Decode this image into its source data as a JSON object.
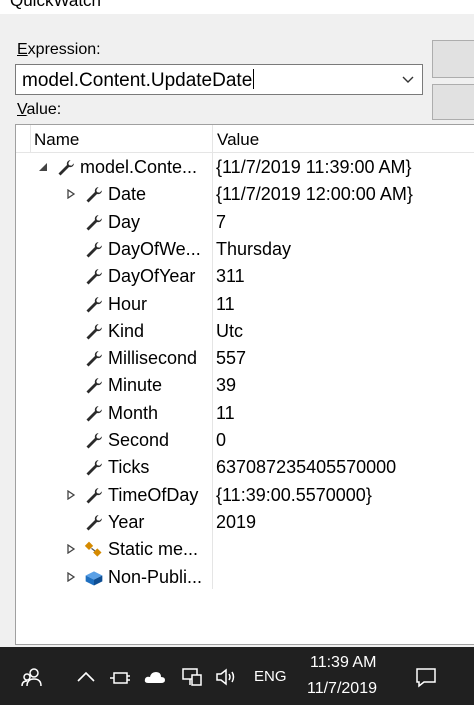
{
  "window": {
    "title": "QuickWatch"
  },
  "expression": {
    "label_prefix": "",
    "label_access": "E",
    "label_rest": "xpression:",
    "value": "model.Content.UpdateDate"
  },
  "value_section": {
    "label_access": "V",
    "label_rest": "alue:"
  },
  "grid": {
    "columns": [
      "Name",
      "Value"
    ],
    "rows": [
      {
        "name": "model.Conte...",
        "value": "{11/7/2019 11:39:00 AM}",
        "expander": "expanded",
        "icon": "wrench-icon",
        "indent": 0
      },
      {
        "name": "Date",
        "value": "{11/7/2019 12:00:00 AM}",
        "expander": "collapsed",
        "icon": "wrench-icon",
        "indent": 1
      },
      {
        "name": "Day",
        "value": "7",
        "expander": "none",
        "icon": "wrench-icon",
        "indent": 1
      },
      {
        "name": "DayOfWe...",
        "value": "Thursday",
        "expander": "none",
        "icon": "wrench-icon",
        "indent": 1
      },
      {
        "name": "DayOfYear",
        "value": "311",
        "expander": "none",
        "icon": "wrench-icon",
        "indent": 1
      },
      {
        "name": "Hour",
        "value": "11",
        "expander": "none",
        "icon": "wrench-icon",
        "indent": 1
      },
      {
        "name": "Kind",
        "value": "Utc",
        "expander": "none",
        "icon": "wrench-icon",
        "indent": 1
      },
      {
        "name": "Millisecond",
        "value": "557",
        "expander": "none",
        "icon": "wrench-icon",
        "indent": 1
      },
      {
        "name": "Minute",
        "value": "39",
        "expander": "none",
        "icon": "wrench-icon",
        "indent": 1
      },
      {
        "name": "Month",
        "value": "11",
        "expander": "none",
        "icon": "wrench-icon",
        "indent": 1
      },
      {
        "name": "Second",
        "value": "0",
        "expander": "none",
        "icon": "wrench-icon",
        "indent": 1
      },
      {
        "name": "Ticks",
        "value": "637087235405570000",
        "expander": "none",
        "icon": "wrench-icon",
        "indent": 1
      },
      {
        "name": "TimeOfDay",
        "value": "{11:39:00.5570000}",
        "expander": "collapsed",
        "icon": "wrench-icon",
        "indent": 1
      },
      {
        "name": "Year",
        "value": "2019",
        "expander": "none",
        "icon": "wrench-icon",
        "indent": 1
      },
      {
        "name": "Static me...",
        "value": "",
        "expander": "collapsed",
        "icon": "static-members-icon",
        "indent": 1
      },
      {
        "name": "Non-Publi...",
        "value": "",
        "expander": "collapsed",
        "icon": "non-public-members-icon",
        "indent": 1
      }
    ]
  },
  "taskbar": {
    "language": "ENG",
    "time": "11:39 AM",
    "date": "11/7/2019",
    "icons": [
      "people-icon",
      "chevron-up-icon",
      "power-plug-icon",
      "cloud-icon",
      "network-icon",
      "speaker-icon",
      "notification-icon"
    ]
  },
  "colors": {
    "taskbar": "#202020",
    "static_icon": "#d58a00",
    "nonpublic_icon": "#1e6fc0"
  }
}
